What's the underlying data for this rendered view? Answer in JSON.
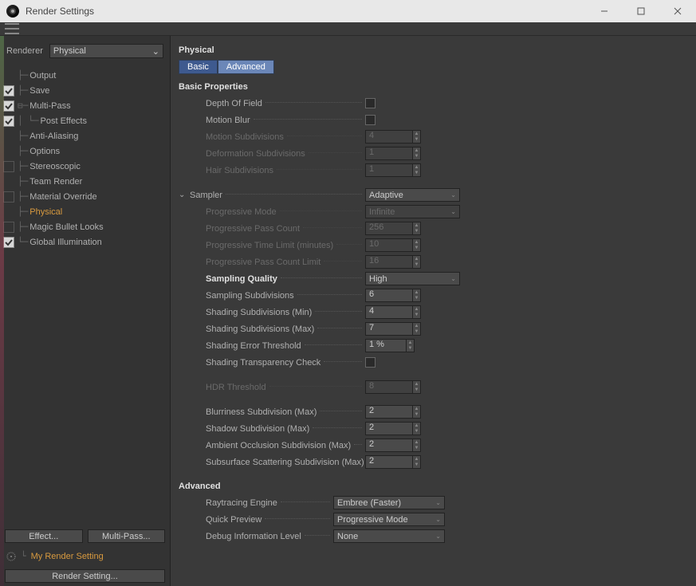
{
  "window": {
    "title": "Render Settings"
  },
  "left": {
    "renderer_label": "Renderer",
    "renderer_value": "Physical",
    "tree": [
      {
        "label": "Output",
        "check": null,
        "indent": 1,
        "active": false
      },
      {
        "label": "Save",
        "check": true,
        "indent": 1,
        "active": false
      },
      {
        "label": "Multi-Pass",
        "check": true,
        "indent": 1,
        "active": false,
        "exp": true
      },
      {
        "label": "Post Effects",
        "check": true,
        "indent": 2,
        "active": false
      },
      {
        "label": "Anti-Aliasing",
        "check": null,
        "indent": 1,
        "active": false
      },
      {
        "label": "Options",
        "check": null,
        "indent": 1,
        "active": false
      },
      {
        "label": "Stereoscopic",
        "check": false,
        "indent": 1,
        "active": false
      },
      {
        "label": "Team Render",
        "check": null,
        "indent": 1,
        "active": false
      },
      {
        "label": "Material Override",
        "check": false,
        "indent": 1,
        "active": false
      },
      {
        "label": "Physical",
        "check": null,
        "indent": 1,
        "active": true
      },
      {
        "label": "Magic Bullet Looks",
        "check": false,
        "indent": 1,
        "active": false
      },
      {
        "label": "Global Illumination",
        "check": true,
        "indent": 1,
        "active": false
      }
    ],
    "effect_btn": "Effect...",
    "multipass_btn": "Multi-Pass...",
    "my_setting": "My Render Setting",
    "render_btn": "Render Setting..."
  },
  "right": {
    "title": "Physical",
    "tabs": {
      "basic": "Basic",
      "advanced": "Advanced"
    },
    "basic_header": "Basic Properties",
    "rows": {
      "dof": "Depth Of Field",
      "mblur": "Motion Blur",
      "msub": {
        "label": "Motion Subdivisions",
        "value": "4"
      },
      "dsub": {
        "label": "Deformation Subdivisions",
        "value": "1"
      },
      "hsub": {
        "label": "Hair Subdivisions",
        "value": "1"
      },
      "sampler": {
        "label": "Sampler",
        "value": "Adaptive"
      },
      "progmode": {
        "label": "Progressive Mode",
        "value": "Infinite"
      },
      "progcount": {
        "label": "Progressive Pass Count",
        "value": "256"
      },
      "progtime": {
        "label": "Progressive Time Limit (minutes)",
        "value": "10"
      },
      "proglimit": {
        "label": "Progressive Pass Count Limit",
        "value": "16"
      },
      "squality": {
        "label": "Sampling Quality",
        "value": "High"
      },
      "sampsub": {
        "label": "Sampling Subdivisions",
        "value": "6"
      },
      "shmin": {
        "label": "Shading Subdivisions (Min)",
        "value": "4"
      },
      "shmax": {
        "label": "Shading Subdivisions (Max)",
        "value": "7"
      },
      "sherr": {
        "label": "Shading Error Threshold",
        "value": "1 %"
      },
      "shtrans": "Shading Transparency Check",
      "hdr": {
        "label": "HDR Threshold",
        "value": "8"
      },
      "blur": {
        "label": "Blurriness Subdivision (Max)",
        "value": "2"
      },
      "shadow": {
        "label": "Shadow Subdivision (Max)",
        "value": "2"
      },
      "ao": {
        "label": "Ambient Occlusion Subdivision (Max)",
        "value": "2"
      },
      "sss": {
        "label": "Subsurface Scattering Subdivision (Max)",
        "value": "2"
      }
    },
    "adv_header": "Advanced",
    "adv": {
      "rtengine": {
        "label": "Raytracing Engine",
        "value": "Embree (Faster)"
      },
      "qpreview": {
        "label": "Quick Preview",
        "value": "Progressive Mode"
      },
      "debug": {
        "label": "Debug Information Level",
        "value": "None"
      }
    }
  }
}
